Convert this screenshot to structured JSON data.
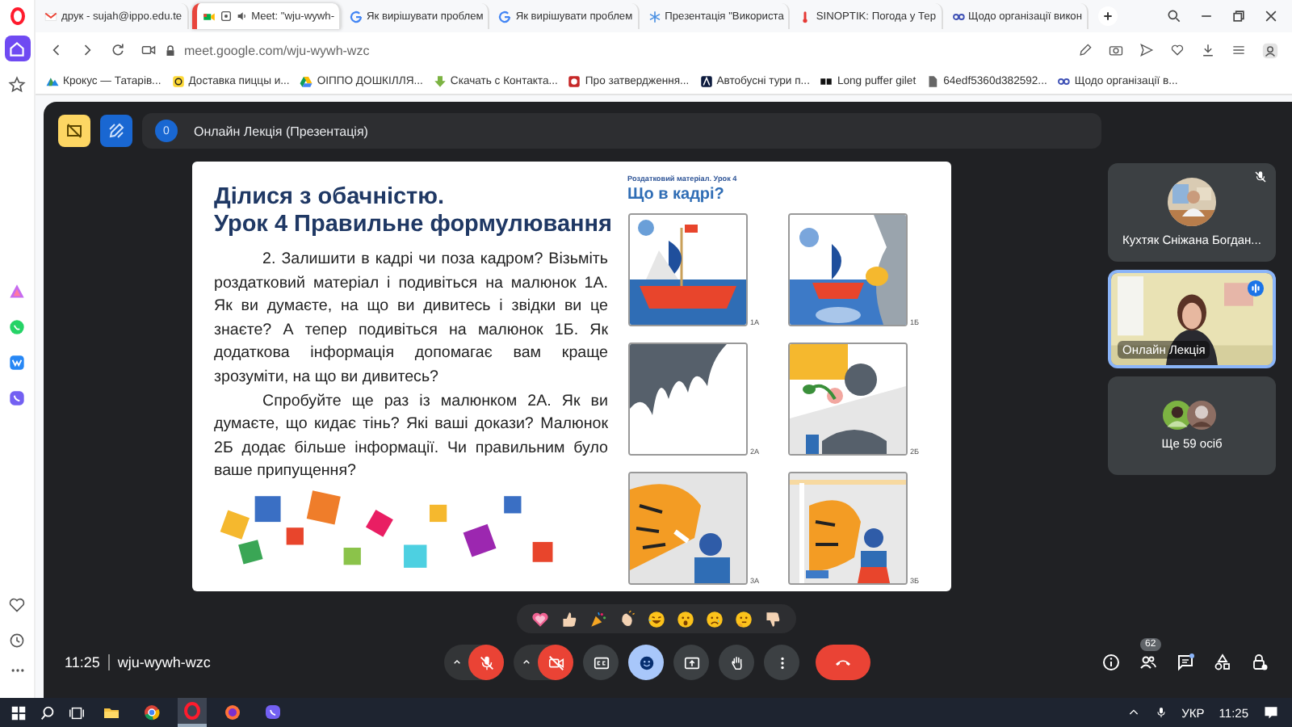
{
  "sidebar": [
    {
      "kind": "home",
      "selected": true
    },
    {
      "kind": "bookmarks",
      "selected": false
    },
    {
      "kind": "aria",
      "selected": false
    },
    {
      "kind": "whatsapp",
      "selected": false
    },
    {
      "kind": "vk",
      "selected": false
    },
    {
      "kind": "viber",
      "selected": false
    },
    {
      "kind": "pinboard",
      "selected": false
    },
    {
      "kind": "history",
      "selected": false
    }
  ],
  "tabs": [
    {
      "title": "друк - sujah@ippo.edu.te",
      "kind": "gmail",
      "selected": false
    },
    {
      "title": "Meet: \"wju-wywh-",
      "kind": "meet",
      "selected": true
    },
    {
      "title": "Як вирішувати проблем",
      "kind": "google",
      "selected": false
    },
    {
      "title": "Як вирішувати проблем",
      "kind": "google",
      "selected": false
    },
    {
      "title": "Презентація \"Використа",
      "kind": "snowflake",
      "selected": false
    },
    {
      "title": "SINOPTIK: Погода у Тер",
      "kind": "thermometer",
      "selected": false
    },
    {
      "title": "Щодо організації викон",
      "kind": "doc",
      "selected": false
    }
  ],
  "address": "meet.google.com/wju-wywh-wzc",
  "bookmarks": [
    {
      "title": "Крокус — Татарів...",
      "kind": "mountain"
    },
    {
      "title": "Доставка пиццы и...",
      "kind": "delivery"
    },
    {
      "title": "ОІППО ДОШКІЛЛЯ...",
      "kind": "drive"
    },
    {
      "title": "Скачать с Контакта...",
      "kind": "download"
    },
    {
      "title": "Про затвердження...",
      "kind": "red"
    },
    {
      "title": "Автобусні тури п...",
      "kind": "arrow"
    },
    {
      "title": "Long puffer gilet",
      "kind": "rb"
    },
    {
      "title": "64edf5360d382592...",
      "kind": "file"
    },
    {
      "title": "Щодо організації в...",
      "kind": "doc"
    }
  ],
  "meet": {
    "presenter_count": "0",
    "title": "Онлайн Лекція (Презентація)",
    "slide": {
      "heading": [
        "Ділися з обачністю.",
        "Урок 4 Правильне формулювання"
      ],
      "paragraphs": [
        "2. Залишити в кадрі чи поза кадром? Візьміть роздатковий матеріал і подивіться на малюнок 1А. Як ви думаєте, на що ви дивитесь і звідки ви це знаєте? А тепер подивіться на малюнок 1Б. Як додаткова інформація допомагає вам краще зрозуміти, на що ви дивитесь?",
        "Спробуйте ще раз із малюнком 2А. Як ви думаєте, що кидає тінь? Які ваші докази? Малюнок 2Б додає більше інформації. Чи правильним було ваше припущення?"
      ],
      "handout": {
        "caption": "Роздатковий матеріал. Урок 4",
        "title": "Що в кадрі?",
        "panels": [
          {
            "label": "1А"
          },
          {
            "label": "1Б"
          },
          {
            "label": "2А"
          },
          {
            "label": "2Б"
          },
          {
            "label": "3А"
          },
          {
            "label": "3Б"
          }
        ]
      }
    },
    "participants": [
      {
        "name": "Кухтяк Сніжана Богдан...",
        "kind": "avatar",
        "muted": true,
        "speaking": false
      },
      {
        "name": "Онлайн Лекція",
        "kind": "video",
        "muted": false,
        "speaking": true
      },
      {
        "name": "Ще 59 осіб",
        "kind": "more",
        "muted": false,
        "speaking": false
      }
    ],
    "time": "11:25",
    "meeting_code": "wju-wywh-wzc",
    "controls": [
      {
        "kind": "mic",
        "on": false
      },
      {
        "kind": "camera",
        "on": false
      },
      {
        "kind": "captions",
        "on": false
      },
      {
        "kind": "reactions",
        "on": true
      },
      {
        "kind": "present",
        "on": false
      },
      {
        "kind": "hand",
        "on": false
      },
      {
        "kind": "more",
        "on": false
      },
      {
        "kind": "leave"
      }
    ],
    "people_count": "62"
  },
  "taskbar": {
    "apps": [
      {
        "kind": "explorer",
        "selected": false
      },
      {
        "kind": "chrome",
        "selected": false
      },
      {
        "kind": "opera",
        "selected": true
      },
      {
        "kind": "firefox",
        "selected": false
      },
      {
        "kind": "viber",
        "selected": false
      }
    ],
    "language": "УКР",
    "time": "11:25"
  }
}
